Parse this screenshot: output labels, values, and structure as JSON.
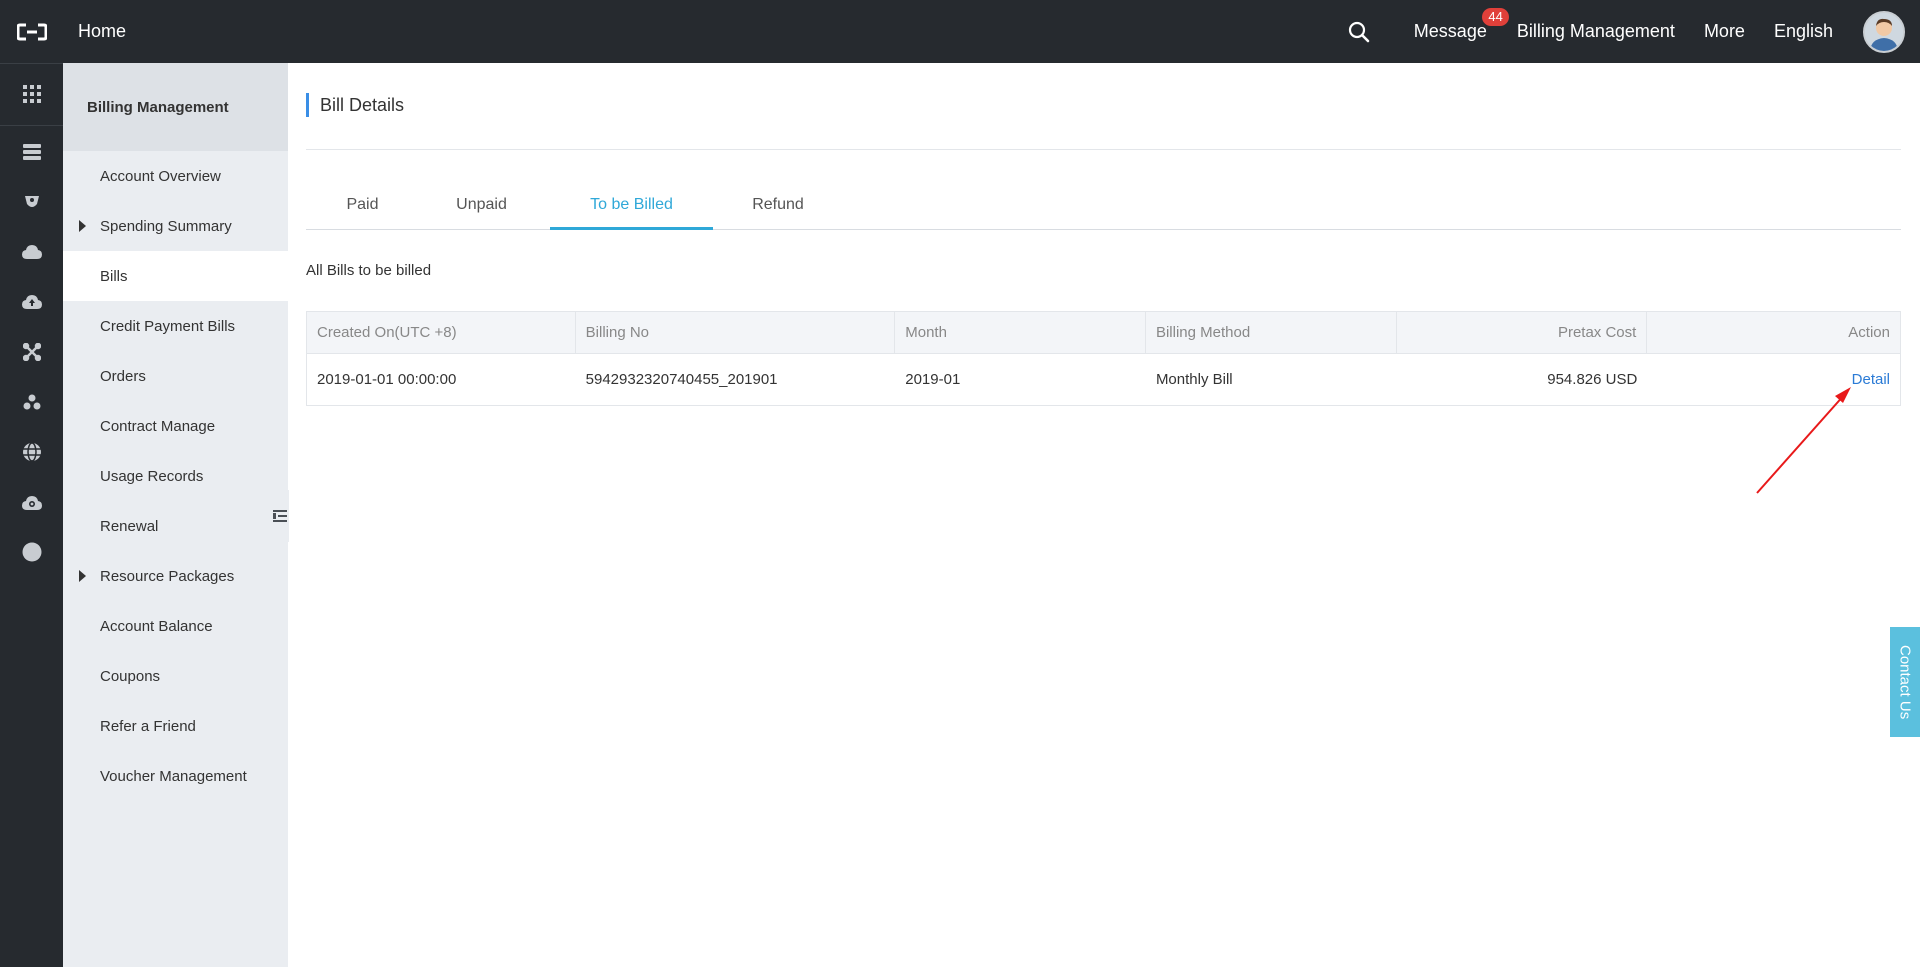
{
  "topbar": {
    "home": "Home",
    "message": "Message",
    "message_badge": "44",
    "billing": "Billing Management",
    "more": "More",
    "language": "English"
  },
  "rail": {
    "icons": [
      "grid-icon",
      "server-icon",
      "database-icon",
      "cloud-upload-icon",
      "cloud-icon",
      "network-icon",
      "cluster-icon",
      "globe-icon",
      "gear-cloud-icon",
      "circle-icon"
    ]
  },
  "sidebar": {
    "title": "Billing Management",
    "items": [
      {
        "label": "Account Overview"
      },
      {
        "label": "Spending Summary"
      },
      {
        "label": "Bills"
      },
      {
        "label": "Credit Payment Bills"
      },
      {
        "label": "Orders"
      },
      {
        "label": "Contract Manage"
      },
      {
        "label": "Usage Records"
      },
      {
        "label": "Renewal"
      },
      {
        "label": "Resource Packages"
      },
      {
        "label": "Account Balance"
      },
      {
        "label": "Coupons"
      },
      {
        "label": "Refer a Friend"
      },
      {
        "label": "Voucher Management"
      }
    ]
  },
  "main": {
    "title": "Bill Details",
    "tabs": [
      {
        "label": "Paid"
      },
      {
        "label": "Unpaid"
      },
      {
        "label": "To be Billed"
      },
      {
        "label": "Refund"
      }
    ],
    "subtitle": "All Bills to be billed",
    "table": {
      "headers": [
        "Created On(UTC +8)",
        "Billing No",
        "Month",
        "Billing Method",
        "Pretax Cost",
        "Action"
      ],
      "rows": [
        {
          "created": "2019-01-01 00:00:00",
          "billing_no": "5942932320740455_201901",
          "month": "2019-01",
          "method": "Monthly Bill",
          "cost": "954.826 USD",
          "action": "Detail"
        }
      ]
    }
  },
  "contact": "Contact Us",
  "colors": {
    "topbar": "#262a2f",
    "accent_tab": "#2fa8d8",
    "link": "#2b7bd6",
    "badge": "#e0403a",
    "annotation_arrow": "#e8191a"
  }
}
